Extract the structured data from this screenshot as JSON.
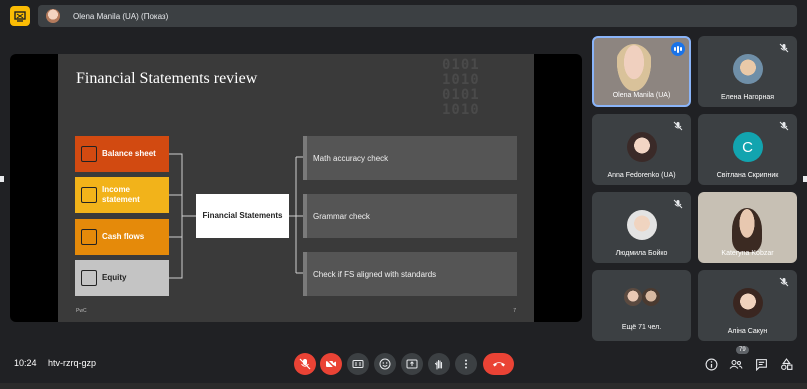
{
  "header": {
    "presenter_label": "Olena Manila (UA) (Показ)"
  },
  "slide": {
    "title": "Financial Statements review",
    "binary_text": "0101\n1010\n0101\n1010",
    "statements": [
      {
        "label": "Balance sheet",
        "color": "#d24a11"
      },
      {
        "label": "Income statement",
        "color": "#f2b31a"
      },
      {
        "label": "Cash flows",
        "color": "#e58a0a"
      },
      {
        "label": "Equity",
        "color": "#c4c4c4"
      }
    ],
    "center_label": "Financial Statements",
    "checks": [
      "Math accuracy check",
      "Grammar check",
      "Check if FS aligned with standards"
    ],
    "footer_left": "PwC",
    "footer_right": "7"
  },
  "participants": [
    {
      "name": "Olena Manila (UA)",
      "speaking": true
    },
    {
      "name": "Елена Нагорная"
    },
    {
      "name": "Anna Fedorenko (UA)"
    },
    {
      "name": "Світлана Скрипник",
      "letter": "C"
    },
    {
      "name": "Людмила Бойко"
    },
    {
      "name": "Kateryna Kobzar"
    },
    {
      "name": "Ещё 71 чел."
    },
    {
      "name": "Аліна Сакун"
    }
  ],
  "controls": {
    "meeting_time": "10:24",
    "meeting_code": "htv-rzrq-gzp",
    "participant_count": "79",
    "accent_red": "#ea4335",
    "accent_blue": "#1a73e8"
  }
}
